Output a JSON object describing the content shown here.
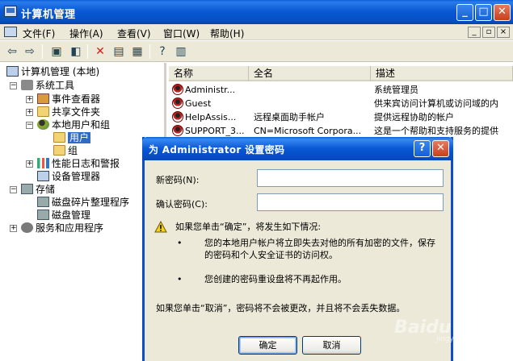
{
  "window": {
    "title": "计算机管理",
    "min_glyph": "_",
    "max_glyph": "□",
    "close_glyph": "✕"
  },
  "menu": {
    "items": [
      "文件(F)",
      "操作(A)",
      "查看(V)",
      "窗口(W)",
      "帮助(H)"
    ],
    "mdi": [
      "_",
      "▫",
      "×"
    ]
  },
  "toolbar": {
    "icons": [
      "back-icon",
      "forward-icon",
      "up-folder-icon",
      "show-tree-icon",
      "delete-icon",
      "properties-icon",
      "export-icon",
      "help-icon",
      "console-icon"
    ]
  },
  "tree": {
    "root": "计算机管理 (本地)",
    "system_tools": "系统工具",
    "event_viewer": "事件查看器",
    "shared_folders": "共享文件夹",
    "local_users_groups": "本地用户和组",
    "users": "用户",
    "groups": "组",
    "perf_logs": "性能日志和警报",
    "device_manager": "设备管理器",
    "storage": "存储",
    "defrag": "磁盘碎片整理程序",
    "disk_mgmt": "磁盘管理",
    "services_apps": "服务和应用程序"
  },
  "list": {
    "columns": [
      "名称",
      "全名",
      "描述"
    ],
    "rows": [
      {
        "name": "Administr...",
        "fullname": "",
        "desc": "系统管理员"
      },
      {
        "name": "Guest",
        "fullname": "",
        "desc": "供来宾访问计算机或访问域的内"
      },
      {
        "name": "HelpAssis...",
        "fullname": "远程桌面助手帐户",
        "desc": "提供远程协助的帐户"
      },
      {
        "name": "SUPPORT_3...",
        "fullname": "CN=Microsoft Corpora...",
        "desc": "这是一个帮助和支持服务的提供"
      }
    ]
  },
  "dialog": {
    "title": "为 Administrator 设置密码",
    "help_glyph": "?",
    "close_glyph": "✕",
    "new_password_label": "新密码(N):",
    "confirm_password_label": "确认密码(C):",
    "new_password_value": "",
    "confirm_password_value": "",
    "warning_heading": "如果您单击“确定”，将发生如下情况:",
    "bullet1": "您的本地用户帐户将立即失去对他的所有加密的文件，保存的密码和个人安全证书的访问权。",
    "bullet2": "您创建的密码重设盘将不再起作用。",
    "cancel_note": "如果您单击“取消”，密码将不会被更改，并且将不会丢失数据。",
    "ok_label": "确定",
    "cancel_label": "取消"
  },
  "watermark": {
    "text": "Baidu 经验",
    "sub": "jingyan.baidu.com"
  }
}
